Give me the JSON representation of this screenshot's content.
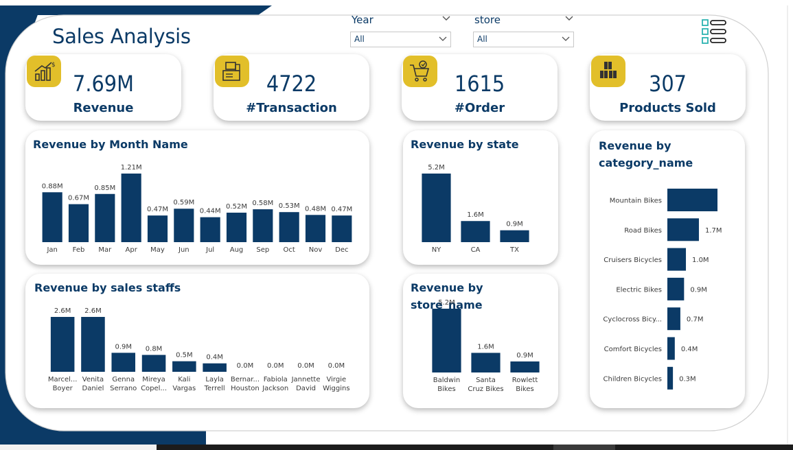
{
  "header": {
    "title": "Sales Analysis"
  },
  "filters": [
    {
      "label": "Year",
      "value": "All"
    },
    {
      "label": "store",
      "value": "All"
    }
  ],
  "kpis": [
    {
      "icon": "revenue-chart-icon",
      "value": "7.69M",
      "label": "Revenue"
    },
    {
      "icon": "cash-register-icon",
      "value": "4722",
      "label": "#Transaction"
    },
    {
      "icon": "shopping-cart-icon",
      "value": "1615",
      "label": "#Order"
    },
    {
      "icon": "boxes-icon",
      "value": "307",
      "label": "Products Sold"
    }
  ],
  "colors": {
    "bar": "#0b3a66",
    "accent": "#e2bf2a",
    "navy": "#0b3a66",
    "menu_icon": "#2bb3b0"
  },
  "chart_data": [
    {
      "id": "month",
      "type": "bar",
      "title": "Revenue by Month Name",
      "categories": [
        "Jan",
        "Feb",
        "Mar",
        "Apr",
        "May",
        "Jun",
        "Jul",
        "Aug",
        "Sep",
        "Oct",
        "Nov",
        "Dec"
      ],
      "values": [
        0.88,
        0.67,
        0.85,
        1.21,
        0.47,
        0.59,
        0.44,
        0.52,
        0.58,
        0.53,
        0.48,
        0.47
      ],
      "labels": [
        "0.88M",
        "0.67M",
        "0.85M",
        "1.21M",
        "0.47M",
        "0.59M",
        "0.44M",
        "0.52M",
        "0.58M",
        "0.53M",
        "0.48M",
        "0.47M"
      ],
      "xlabel": "",
      "ylabel": ""
    },
    {
      "id": "state",
      "type": "bar",
      "title": "Revenue by state",
      "categories": [
        "NY",
        "CA",
        "TX"
      ],
      "values": [
        5.2,
        1.6,
        0.9
      ],
      "labels": [
        "5.2M",
        "1.6M",
        "0.9M"
      ],
      "xlabel": "",
      "ylabel": ""
    },
    {
      "id": "staff",
      "type": "bar",
      "title": "Revenue by sales staffs",
      "categories": [
        [
          "Marcel...",
          "Boyer"
        ],
        [
          "Venita",
          "Daniel"
        ],
        [
          "Genna",
          "Serrano"
        ],
        [
          "Mireya",
          "Copel..."
        ],
        [
          "Kali",
          "Vargas"
        ],
        [
          "Layla",
          "Terrell"
        ],
        [
          "Bernar...",
          "Houston"
        ],
        [
          "Fabiola",
          "Jackson"
        ],
        [
          "Jannette",
          "David"
        ],
        [
          "Virgie",
          "Wiggins"
        ]
      ],
      "values": [
        2.6,
        2.6,
        0.9,
        0.8,
        0.5,
        0.4,
        0.0,
        0.0,
        0.0,
        0.0
      ],
      "labels": [
        "2.6M",
        "2.6M",
        "0.9M",
        "0.8M",
        "0.5M",
        "0.4M",
        "0.0M",
        "0.0M",
        "0.0M",
        "0.0M"
      ],
      "xlabel": "",
      "ylabel": ""
    },
    {
      "id": "store",
      "type": "bar",
      "title": "Revenue by store_name",
      "categories": [
        [
          "Baldwin",
          "Bikes"
        ],
        [
          "Santa",
          "Cruz Bikes"
        ],
        [
          "Rowlett",
          "Bikes"
        ]
      ],
      "values": [
        5.2,
        1.6,
        0.9
      ],
      "labels": [
        "5.2M",
        "1.6M",
        "0.9M"
      ],
      "xlabel": "",
      "ylabel": ""
    },
    {
      "id": "category",
      "type": "bar",
      "orientation": "horizontal",
      "title": "Revenue by category_name",
      "categories": [
        "Mountain Bikes",
        "Road Bikes",
        "Cruisers Bicycles",
        "Electric Bikes",
        "Cyclocross Bicy...",
        "Comfort Bicycles",
        "Children Bicycles"
      ],
      "values": [
        2.7,
        1.7,
        1.0,
        0.9,
        0.7,
        0.4,
        0.3
      ],
      "labels": [
        "",
        "1.7M",
        "1.0M",
        "0.9M",
        "0.7M",
        "0.4M",
        "0.3M"
      ],
      "xlabel": "",
      "ylabel": ""
    }
  ]
}
